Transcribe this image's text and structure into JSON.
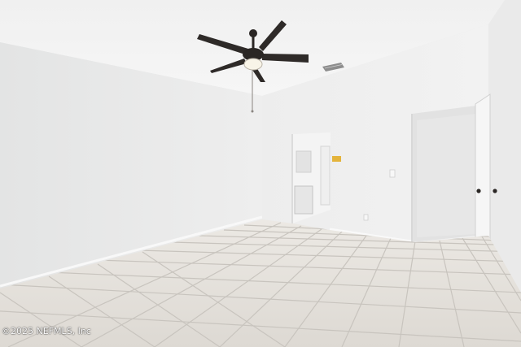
{
  "photo": {
    "watermark": "©2025 NEFMLS, Inc",
    "colors": {
      "ceiling": "#f3f3f3",
      "left_wall": "#e8e8e8",
      "back_wall": "#ececec",
      "right_wall": "#eeeeee",
      "floor_tile": "#e6e3de",
      "grout": "#c9c5bf",
      "fan_dark": "#2a2624"
    }
  }
}
